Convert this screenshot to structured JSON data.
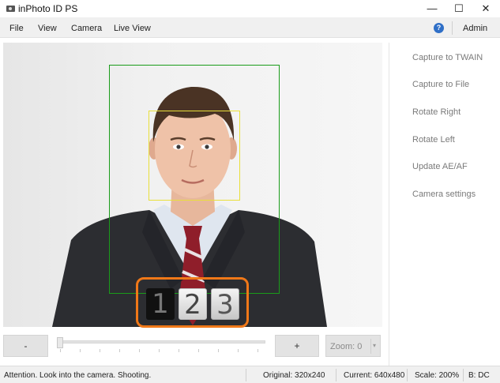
{
  "window": {
    "title": "inPhoto ID PS",
    "minimize": "—",
    "maximize": "☐",
    "close": "✕"
  },
  "menu": {
    "items": [
      "File",
      "View",
      "Camera",
      "Live View"
    ],
    "help": "?",
    "admin": "Admin"
  },
  "camera": {
    "countdown": [
      "1",
      "2",
      "3"
    ]
  },
  "actions": [
    "Capture to TWAIN",
    "Capture to File",
    "Rotate Right",
    "Rotate Left",
    "Update AE/AF",
    "Camera settings"
  ],
  "controls": {
    "minus": "-",
    "plus": "+",
    "zoom": "Zoom: 0",
    "zoom_arrow": "▾"
  },
  "status": {
    "message": "Attention. Look into the camera. Shooting.",
    "original": "Original: 320x240",
    "current": "Current: 640x480",
    "scale": "Scale: 200%",
    "b": "B: DC"
  },
  "colors": {
    "face_frame": "#1a9c1a",
    "eye_frame": "#e9df3a",
    "countdown_border": "#f07818",
    "help_icon": "#2f6fc7"
  }
}
